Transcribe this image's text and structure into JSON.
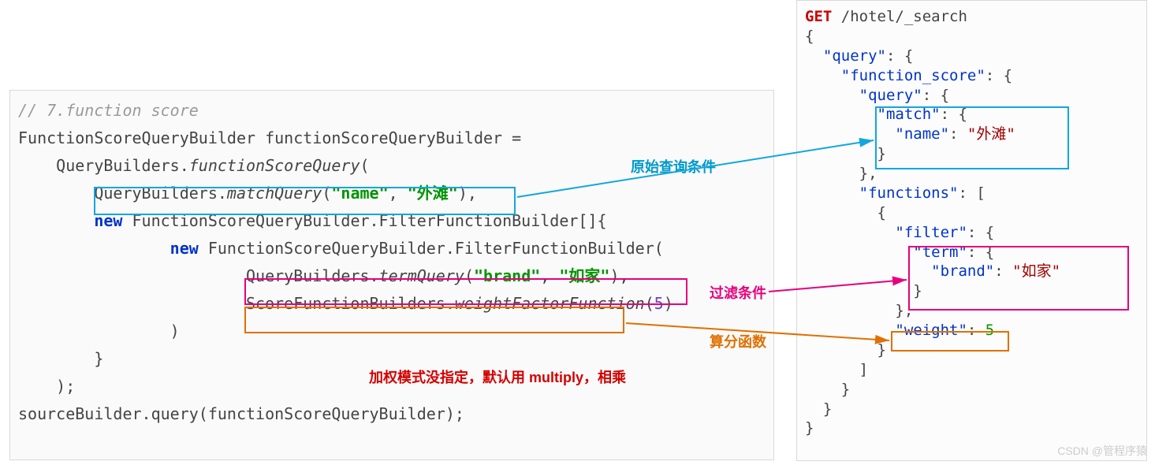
{
  "left": {
    "comment": "// 7.function score",
    "l1": "FunctionScoreQueryBuilder functionScoreQueryBuilder =",
    "l2a": "    QueryBuilders.",
    "l2b": "functionScoreQuery",
    "l2c": "(",
    "l3a": "        QueryBuilders.",
    "l3b": "matchQuery",
    "l3c": "(",
    "l3d": "\"name\"",
    "l3e": ", ",
    "l3f": "\"外滩\"",
    "l3g": "),",
    "l4a": "        ",
    "l4b": "new",
    "l4c": " FunctionScoreQueryBuilder.FilterFunctionBuilder[]{",
    "l5a": "                ",
    "l5b": "new",
    "l5c": " FunctionScoreQueryBuilder.FilterFunctionBuilder(",
    "l6a": "                        QueryBuilders.",
    "l6b": "termQuery",
    "l6c": "(",
    "l6d": "\"brand\"",
    "l6e": ", ",
    "l6f": "\"如家\"",
    "l6g": "),",
    "l7a": "                        ScoreFunctionBuilders.",
    "l7b": "weightFactorFunction",
    "l7c": "(",
    "l7d": "5",
    "l7e": ")",
    "l8": "                )",
    "l9": "        }",
    "l10": "    );",
    "l11": "sourceBuilder.query(functionScoreQueryBuilder);"
  },
  "right": {
    "r1a": "GET",
    "r1b": " /hotel/_search",
    "r2": "{",
    "r3a": "  ",
    "r3b": "\"query\"",
    "r3c": ": {",
    "r4a": "    ",
    "r4b": "\"function_score\"",
    "r4c": ": {",
    "r5a": "      ",
    "r5b": "\"query\"",
    "r5c": ": {",
    "r6a": "        ",
    "r6b": "\"match\"",
    "r6c": ": {",
    "r7a": "          ",
    "r7b": "\"name\"",
    "r7c": ": ",
    "r7d": "\"外滩\"",
    "r8": "        }",
    "r9": "      },",
    "r10a": "      ",
    "r10b": "\"functions\"",
    "r10c": ": [",
    "r11": "        {",
    "r12a": "          ",
    "r12b": "\"filter\"",
    "r12c": ": {",
    "r13a": "            ",
    "r13b": "\"term\"",
    "r13c": ": {",
    "r14a": "              ",
    "r14b": "\"brand\"",
    "r14c": ": ",
    "r14d": "\"如家\"",
    "r15": "            }",
    "r16": "          },",
    "r17a": "          ",
    "r17b": "\"weight\"",
    "r17c": ": ",
    "r17d": "5",
    "r18": "        }",
    "r19": "      ]",
    "r20": "    }",
    "r21": "  }",
    "r22": "}"
  },
  "labels": {
    "original": "原始查询条件",
    "filter": "过滤条件",
    "scorefn": "算分函数",
    "multiply": "加权模式没指定，默认用 multiply，相乘"
  },
  "watermark": "CSDN @管程序猿"
}
